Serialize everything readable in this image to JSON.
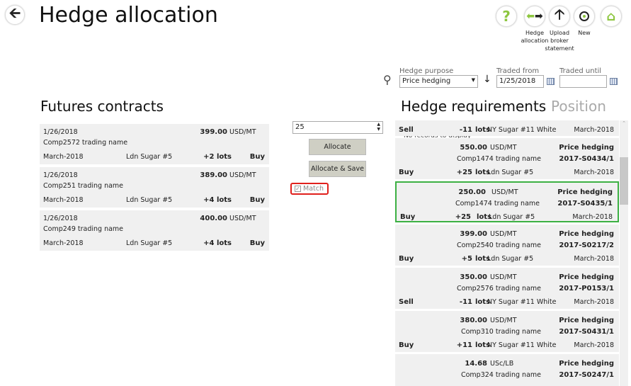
{
  "header": {
    "title": "Hedge allocation",
    "back_icon": "arrow-left-icon"
  },
  "toolbar": [
    {
      "name": "help",
      "icon": "question-icon",
      "label": "",
      "color": "#8dc63f"
    },
    {
      "name": "hedge-allocation",
      "icon": "swap-arrows-icon",
      "label": "Hedge allocation"
    },
    {
      "name": "upload-broker-statement",
      "icon": "arrow-up-icon",
      "label": "Upload broker statement"
    },
    {
      "name": "new",
      "icon": "plus-circle-icon",
      "label": "New"
    },
    {
      "name": "home",
      "icon": "home-icon",
      "label": "",
      "color": "#8dc63f"
    }
  ],
  "filters": {
    "hedge_purpose_label": "Hedge purpose",
    "hedge_purpose_value": "Price hedging",
    "traded_from_label": "Traded from",
    "traded_from_value": "1/25/2018",
    "traded_until_label": "Traded until",
    "traded_until_value": ""
  },
  "futures": {
    "title": "Futures contracts",
    "items": [
      {
        "date": "1/26/2018",
        "company": "Comp2572 trading name",
        "price": "399.00",
        "unit": "USD/MT",
        "month": "March-2018",
        "market": "Ldn Sugar #5",
        "lots": "+2 lots",
        "side": "Buy"
      },
      {
        "date": "1/26/2018",
        "company": "Comp251 trading name",
        "price": "389.00",
        "unit": "USD/MT",
        "month": "March-2018",
        "market": "Ldn Sugar #5",
        "lots": "+4 lots",
        "side": "Buy"
      },
      {
        "date": "1/26/2018",
        "company": "Comp249 trading name",
        "price": "400.00",
        "unit": "USD/MT",
        "month": "March-2018",
        "market": "Ldn Sugar #5",
        "lots": "+4 lots",
        "side": "Buy"
      }
    ]
  },
  "allocate": {
    "quantity": "25",
    "allocate_label": "Allocate",
    "allocate_save_label": "Allocate & Save",
    "match_label": "Match",
    "match_checked": true
  },
  "requirements": {
    "title": "Hedge requirements",
    "tab_position": "Position",
    "no_records": "No records to display",
    "top_partial": {
      "side": "Sell",
      "qty": "-11",
      "lots": "lots",
      "market": "NY Sugar #11 White",
      "month": "March-2018"
    },
    "items": [
      {
        "price": "550.00",
        "unit": "USD/MT",
        "purpose": "Price hedging",
        "company": "Comp1474 trading name",
        "ref": "2017-S0434/1",
        "side": "Buy",
        "qty": "+25",
        "lots": "lots",
        "market": "Ldn Sugar #5",
        "month": "March-2018",
        "selected": false
      },
      {
        "price": "250.00",
        "unit": "USD/MT",
        "purpose": "Price hedging",
        "company": "Comp1474 trading name",
        "ref": "2017-S0435/1",
        "side": "Buy",
        "qty": "+25",
        "lots": "lots",
        "market": "Ldn Sugar #5",
        "month": "March-2018",
        "selected": true
      },
      {
        "price": "399.00",
        "unit": "USD/MT",
        "purpose": "Price hedging",
        "company": "Comp2540 trading name",
        "ref": "2017-S0217/2",
        "side": "Buy",
        "qty": "+5",
        "lots": "lots",
        "market": "Ldn Sugar #5",
        "month": "March-2018",
        "selected": false
      },
      {
        "price": "350.00",
        "unit": "USD/MT",
        "purpose": "Price hedging",
        "company": "Comp2576 trading name",
        "ref": "2017-P0153/1",
        "side": "Sell",
        "qty": "-11",
        "lots": "lots",
        "market": "NY Sugar #11 White",
        "month": "March-2018",
        "selected": false
      },
      {
        "price": "380.00",
        "unit": "USD/MT",
        "purpose": "Price hedging",
        "company": "Comp310 trading name",
        "ref": "2017-S0431/1",
        "side": "Buy",
        "qty": "+11",
        "lots": "lots",
        "market": "NY Sugar #11 White",
        "month": "March-2018",
        "selected": false
      },
      {
        "price": "14.68",
        "unit": "USc/LB",
        "purpose": "Price hedging",
        "company": "Comp324 trading name",
        "ref": "2017-S0247/1",
        "side": "",
        "qty": "",
        "lots": "",
        "market": "",
        "month": "",
        "selected": false
      }
    ]
  },
  "colors": {
    "accent_green": "#8dc63f",
    "selected_border": "#3cb043",
    "match_border": "#e0201c"
  }
}
